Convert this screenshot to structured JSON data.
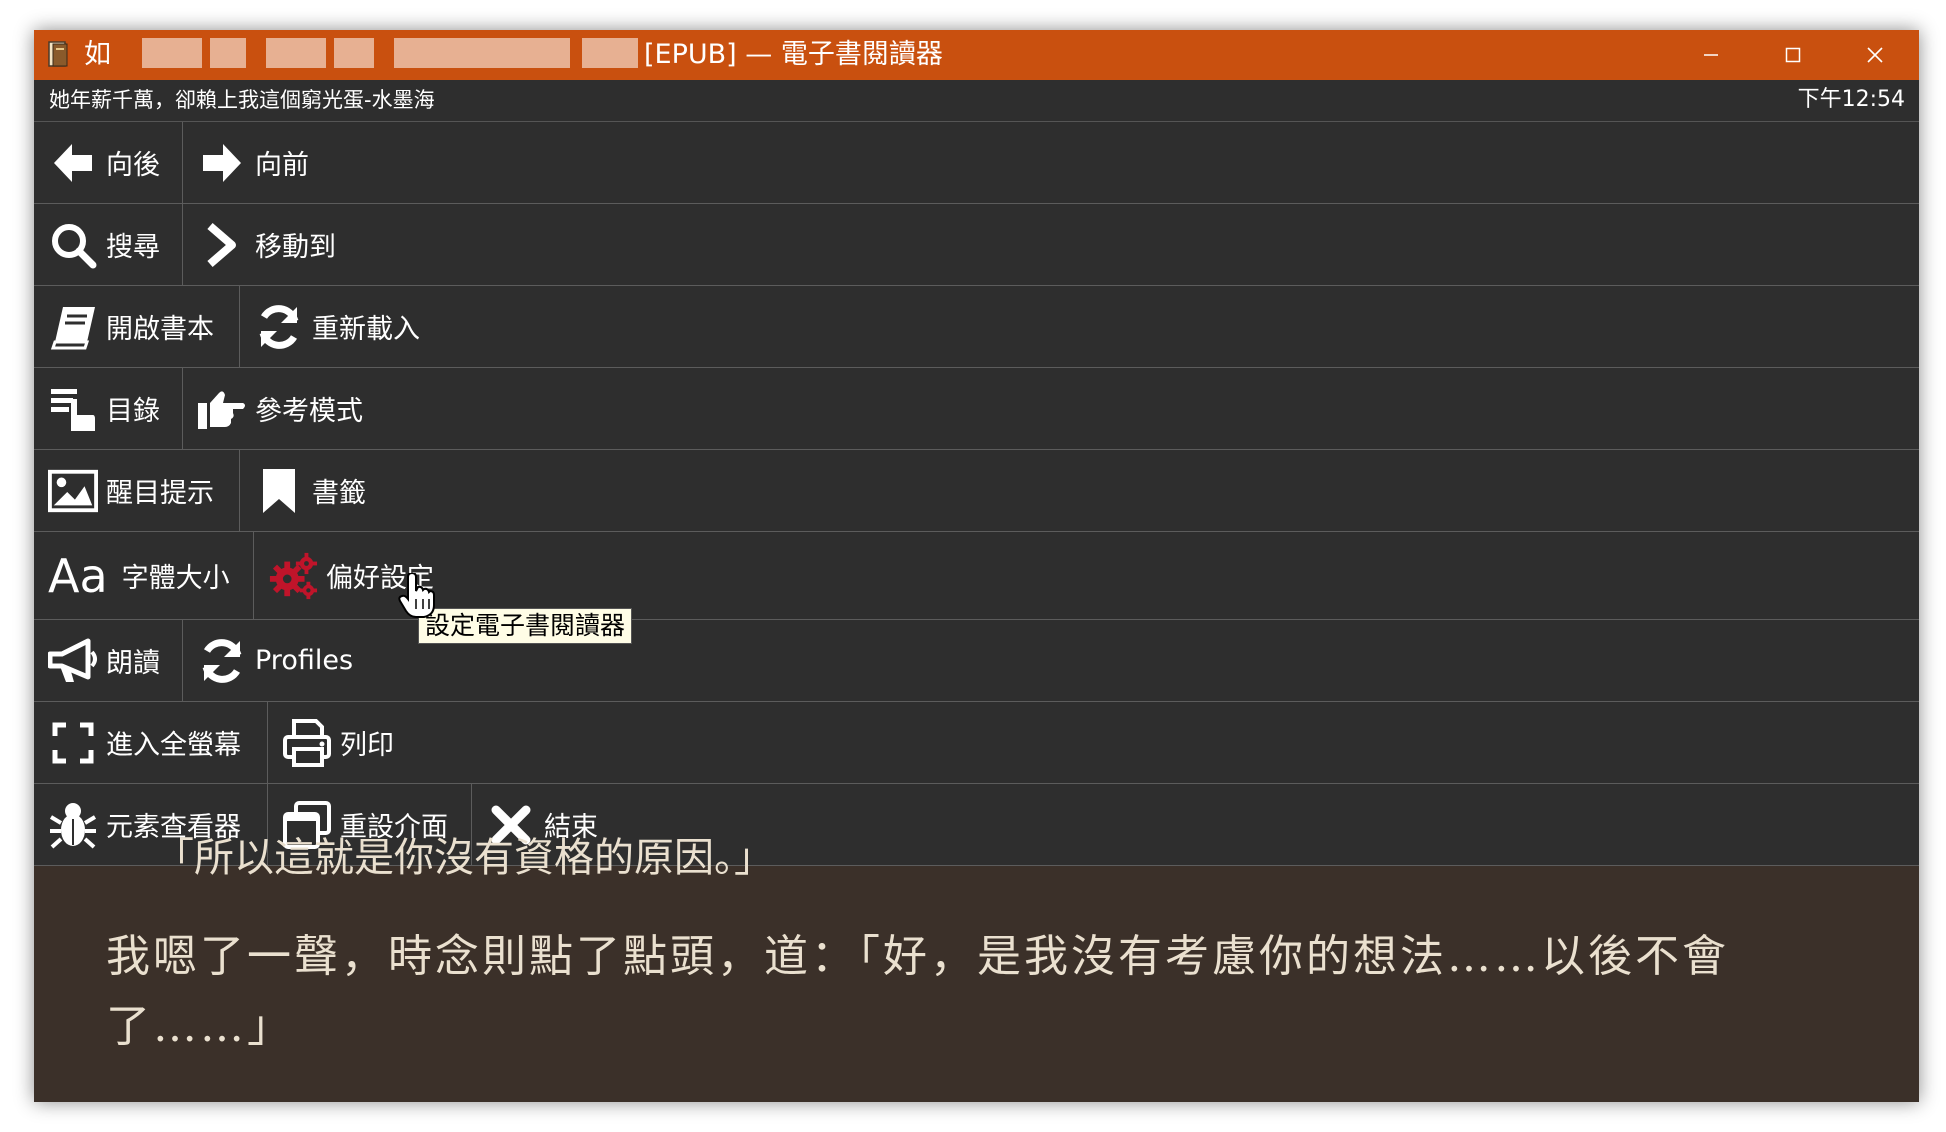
{
  "window": {
    "title_prefix": "如",
    "title_suffix": "[EPUB] — 電子書閱讀器",
    "minimize_label": "—",
    "maximize_label": "☐",
    "close_label": "✕"
  },
  "status": {
    "book_title": "她年薪千萬，卻賴上我這個窮光蛋-水墨海",
    "time": "下午12:54"
  },
  "menu": {
    "back": "向後",
    "forward": "向前",
    "search": "搜尋",
    "goto": "移動到",
    "open_book": "開啟書本",
    "reload": "重新載入",
    "toc": "目錄",
    "reference_mode": "參考模式",
    "highlights": "醒目提示",
    "bookmarks": "書籤",
    "font_size_glyph": "Aa",
    "font_size": "字體大小",
    "preferences": "偏好設定",
    "read_aloud": "朗讀",
    "profiles": "Profiles",
    "fullscreen": "進入全螢幕",
    "print": "列印",
    "inspector": "元素查看器",
    "reset_interface": "重設介面",
    "quit": "結束"
  },
  "tooltip": "設定電子書閱讀器",
  "reading": {
    "partial_line": "「所以這就是你沒有資格的原因。」",
    "paragraph": "我嗯了一聲，時念則點了點頭，道：「好，是我沒有考慮你的想法……以後不會了……」"
  },
  "colors": {
    "titlebar": "#c9500f",
    "menu_bg": "#2e2e2e",
    "reading_bg": "#3b3029",
    "reading_text": "#eae0cf",
    "gear_accent": "#c0142a"
  }
}
